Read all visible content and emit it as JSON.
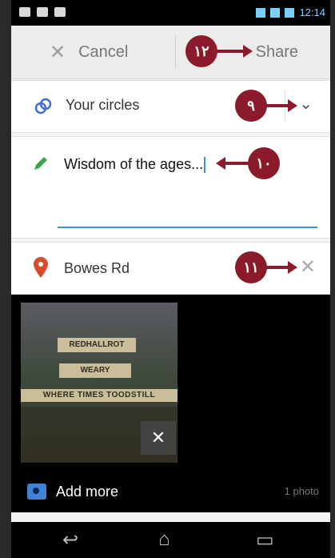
{
  "status_bar": {
    "time": "12:14"
  },
  "action_bar": {
    "cancel_label": "Cancel",
    "share_label": "Share"
  },
  "audience": {
    "label": "Your circles"
  },
  "post": {
    "text": "Wisdom of the ages..."
  },
  "location": {
    "label": "Bowes Rd"
  },
  "media": {
    "sign_lines": [
      "REDHALLROT",
      "WEARY",
      "WHERE TIMES TOODSTILL"
    ],
    "add_more_label": "Add more",
    "photo_count": "1 photo"
  },
  "callouts": {
    "share": "١٢",
    "circles": "٩",
    "post": "١٠",
    "location": "١١"
  },
  "colors": {
    "accent": "#3a8fd9",
    "callout": "#8b1b2b",
    "pin": "#d94b2b",
    "pencil": "#3fa34d"
  }
}
